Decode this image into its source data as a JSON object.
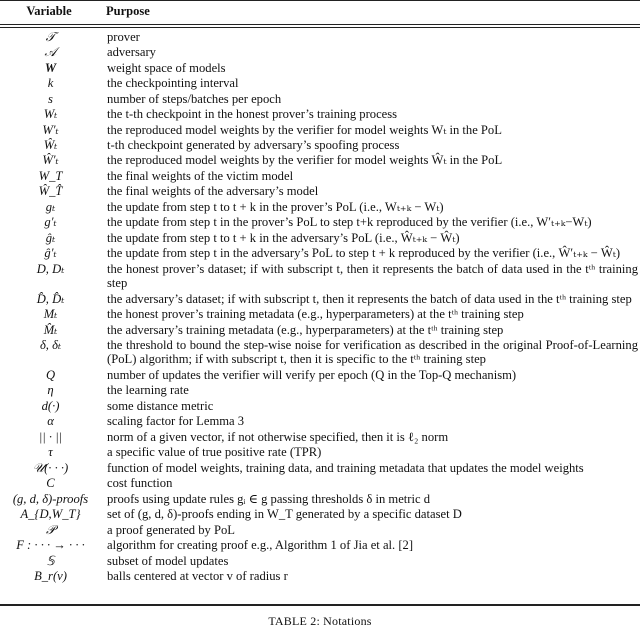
{
  "table": {
    "headers": {
      "variable": "Variable",
      "purpose": "Purpose"
    },
    "rows": [
      {
        "variable": "𝒯",
        "purpose": "prover"
      },
      {
        "variable": "𝒜",
        "purpose": "adversary"
      },
      {
        "variable": "W",
        "purpose": "weight space of models"
      },
      {
        "variable": "k",
        "purpose": "the checkpointing interval"
      },
      {
        "variable": "s",
        "purpose": "number of steps/batches per epoch"
      },
      {
        "variable": "Wₜ",
        "purpose": "the t-th checkpoint in the honest prover’s training process"
      },
      {
        "variable": "W′ₜ",
        "purpose": "the reproduced model weights by the verifier for model weights Wₜ in the PoL"
      },
      {
        "variable": "Ŵₜ",
        "purpose": "t-th checkpoint generated by adversary’s spoofing process"
      },
      {
        "variable": "Ŵ′ₜ",
        "purpose": "the reproduced model weights by the verifier for model weights Ŵₜ in the PoL"
      },
      {
        "variable": "W_T",
        "purpose": "the final weights of the victim model"
      },
      {
        "variable": "Ŵ_T̂",
        "purpose": "the final weights of the adversary’s model"
      },
      {
        "variable": "gₜ",
        "purpose": "the update from step t to t + k in the prover’s PoL (i.e., Wₜ₊ₖ − Wₜ)"
      },
      {
        "variable": "g′ₜ",
        "purpose": "the update from step t in the prover’s PoL to step t+k reproduced by the verifier (i.e., W′ₜ₊ₖ−Wₜ)"
      },
      {
        "variable": "ĝₜ",
        "purpose": "the update from step t to t + k in the adversary’s PoL (i.e., Ŵₜ₊ₖ − Ŵₜ)"
      },
      {
        "variable": "ĝ′ₜ",
        "purpose": "the update from step t in the adversary’s PoL to step t + k reproduced by the verifier (i.e., Ŵ′ₜ₊ₖ − Ŵₜ)"
      },
      {
        "variable": "D, Dₜ",
        "purpose": "the honest prover’s dataset; if with subscript t, then it represents the batch of data used in the tᵗʰ training step"
      },
      {
        "variable": "D̂, D̂ₜ",
        "purpose": "the adversary’s dataset; if with subscript t, then it represents the batch of data used in the tᵗʰ training step"
      },
      {
        "variable": "Mₜ",
        "purpose": "the honest prover’s training metadata (e.g., hyperparameters) at the tᵗʰ training step"
      },
      {
        "variable": "M̂ₜ",
        "purpose": "the adversary’s training metadata (e.g., hyperparameters) at the tᵗʰ training step"
      },
      {
        "variable": "δ, δₜ",
        "purpose": "the threshold to bound the step-wise noise for verification as described in the original Proof-of-Learning (PoL) algorithm; if with subscript t, then it is specific to the tᵗʰ training step"
      },
      {
        "variable": "Q",
        "purpose": "number of updates the verifier will verify per epoch (Q in the Top-Q mechanism)"
      },
      {
        "variable": "η",
        "purpose": "the learning rate"
      },
      {
        "variable": "d(·)",
        "purpose": "some distance metric"
      },
      {
        "variable": "α",
        "purpose": "scaling factor for Lemma 3"
      },
      {
        "variable": "|| · ||",
        "purpose": "norm of a given vector, if not otherwise specified, then it is ℓ₂ norm"
      },
      {
        "variable": "τ",
        "purpose": "a specific value of true positive rate (TPR)"
      },
      {
        "variable": "𝒰(· · ·)",
        "purpose": "function of model weights, training data, and training metadata that updates the model weights"
      },
      {
        "variable": "C",
        "purpose": "cost function"
      },
      {
        "variable": "(g, d, δ)-proofs",
        "purpose": "proofs using update rules gᵢ ∈ g passing thresholds δ in metric d"
      },
      {
        "variable": "A_{D,W_T}",
        "purpose": "set of (g, d, δ)-proofs ending in W_T generated by a specific dataset D"
      },
      {
        "variable": "𝒫",
        "purpose": "a proof generated by PoL"
      },
      {
        "variable": "F : · · · → · · ·",
        "purpose": "algorithm for creating proof e.g., Algorithm 1 of Jia et al. [2]"
      },
      {
        "variable": "𝕊",
        "purpose": "subset of model updates"
      },
      {
        "variable": "B_r(v)",
        "purpose": "balls centered at vector v of radius r"
      }
    ]
  },
  "caption": "TABLE 2: Notations"
}
